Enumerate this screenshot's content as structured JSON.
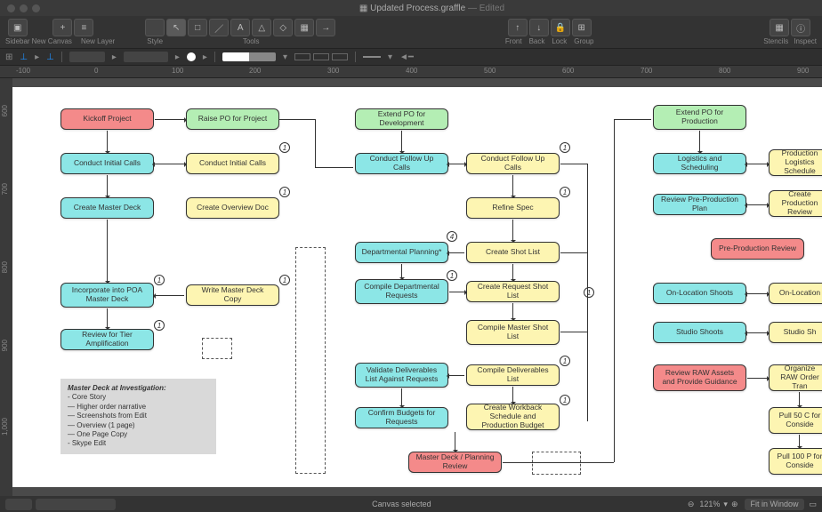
{
  "window": {
    "title": "Updated Process.graffle",
    "subtitle": "— Edited"
  },
  "toolbar": {
    "sidebar": "Sidebar",
    "newCanvas": "New Canvas",
    "newLayer": "New Layer",
    "style": "Style",
    "tools": "Tools",
    "front": "Front",
    "back": "Back",
    "lock": "Lock",
    "group": "Group",
    "stencils": "Stencils",
    "inspect": "Inspect"
  },
  "ruler_h": [
    "-100",
    "0",
    "100",
    "200",
    "300",
    "400",
    "500",
    "600",
    "700",
    "800",
    "900"
  ],
  "ruler_v": [
    "600",
    "700",
    "800",
    "900",
    "1,000"
  ],
  "nodes": {
    "n1": "Kickoff Project",
    "n2": "Raise PO for Project",
    "n3": "Conduct Initial Calls",
    "n4": "Conduct Initial Calls",
    "n5": "Create Master Deck",
    "n6": "Create Overview Doc",
    "n7": "Incorporate into POA Master Deck",
    "n8": "Write Master Deck Copy",
    "n9": "Review for Tier Amplification",
    "n10": "Extend PO for Development",
    "n11": "Conduct Follow Up Calls",
    "n12": "Conduct Follow Up Calls",
    "n13": "Refine Spec",
    "n14": "Departmental Planning*",
    "n15": "Create Shot List",
    "n16": "Compile Departmental Requests",
    "n17": "Create Request Shot List",
    "n18": "Compile Master Shot List",
    "n19": "Validate Deliverables List Against Requests",
    "n20": "Compile Deliverables List",
    "n21": "Confirm Budgets for Requests",
    "n22": "Create Workback Schedule and Production Budget",
    "n23": "Master Deck / Planning Review",
    "n24": "Extend PO for Production",
    "n25": "Logistics and Scheduling",
    "n26": "Production Logistics Schedule",
    "n27": "Review Pre-Production Plan",
    "n28": "Create Production Review",
    "n29": "Pre-Production Review",
    "n30": "On-Location Shoots",
    "n31": "On-Location",
    "n32": "Studio Shoots",
    "n33": "Studio Sh",
    "n34": "Review RAW Assets and Provide Guidance",
    "n35": "Organize RAW Order Tran",
    "n36": "Pull 50 C for Conside",
    "n37": "Pull 100 P for Conside"
  },
  "badges": {
    "b1": "1",
    "b2": "1",
    "b3": "1",
    "b4": "1",
    "b5": "4",
    "b6": "1",
    "b7": "1",
    "b8": "1",
    "b9": "1",
    "b10": "1",
    "b11": "1",
    "b12": "1"
  },
  "note": {
    "title": "Master Deck at Investigation:",
    "lines": [
      "- Core Story",
      "— Higher order narrative",
      "— Screenshots from Edit",
      "— Overview (1 page)",
      "— One Page Copy",
      "- Skype Edit"
    ]
  },
  "status": {
    "text": "Canvas selected",
    "zoom": "121%",
    "fit": "Fit in Window"
  }
}
